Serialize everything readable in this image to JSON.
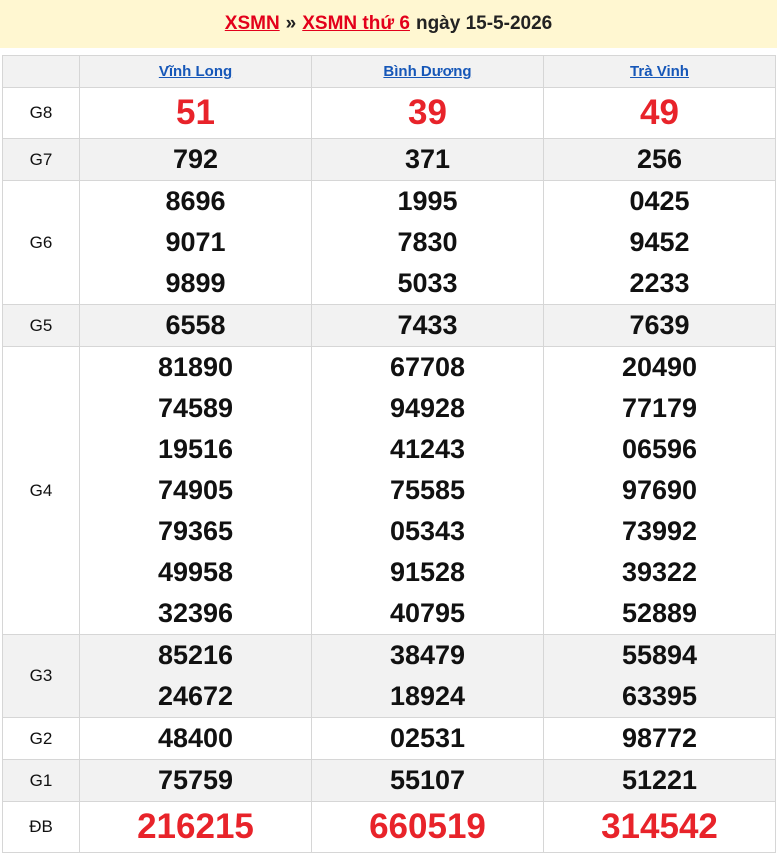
{
  "header": {
    "link1": "XSMN",
    "separator": "»",
    "link2": "XSMN thứ 6",
    "date": "ngày 15-5-2026"
  },
  "provinces": [
    "Vĩnh Long",
    "Bình Dương",
    "Trà Vinh"
  ],
  "prizes": [
    {
      "label": "G8",
      "values": [
        [
          "51"
        ],
        [
          "39"
        ],
        [
          "49"
        ]
      ]
    },
    {
      "label": "G7",
      "values": [
        [
          "792"
        ],
        [
          "371"
        ],
        [
          "256"
        ]
      ]
    },
    {
      "label": "G6",
      "values": [
        [
          "8696",
          "9071",
          "9899"
        ],
        [
          "1995",
          "7830",
          "5033"
        ],
        [
          "0425",
          "9452",
          "2233"
        ]
      ]
    },
    {
      "label": "G5",
      "values": [
        [
          "6558"
        ],
        [
          "7433"
        ],
        [
          "7639"
        ]
      ]
    },
    {
      "label": "G4",
      "values": [
        [
          "81890",
          "74589",
          "19516",
          "74905",
          "79365",
          "49958",
          "32396"
        ],
        [
          "67708",
          "94928",
          "41243",
          "75585",
          "05343",
          "91528",
          "40795"
        ],
        [
          "20490",
          "77179",
          "06596",
          "97690",
          "73992",
          "39322",
          "52889"
        ]
      ]
    },
    {
      "label": "G3",
      "values": [
        [
          "85216",
          "24672"
        ],
        [
          "38479",
          "18924"
        ],
        [
          "55894",
          "63395"
        ]
      ]
    },
    {
      "label": "G2",
      "values": [
        [
          "48400"
        ],
        [
          "02531"
        ],
        [
          "98772"
        ]
      ]
    },
    {
      "label": "G1",
      "values": [
        [
          "75759"
        ],
        [
          "55107"
        ],
        [
          "51221"
        ]
      ]
    },
    {
      "label": "ĐB",
      "values": [
        [
          "216215"
        ],
        [
          "660519"
        ],
        [
          "314542"
        ]
      ]
    }
  ],
  "colors": {
    "accent_red": "#e8232a",
    "link_blue": "#1657b8",
    "header_bg": "#fff7d1",
    "row_shade": "#f2f2f2"
  }
}
